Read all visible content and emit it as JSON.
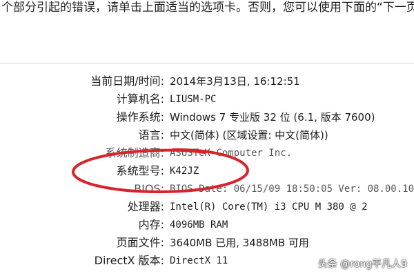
{
  "header": {
    "instruction_text": "个部分引起的错误，请单击上面适当的选项卡。否则，您可以使用下面的“下一页”"
  },
  "system_info": {
    "rows": [
      {
        "label": "当前日期/时间:",
        "value": "2014年3月13日, 16:12:51"
      },
      {
        "label": "计算机名:",
        "value": "LIUSM-PC"
      },
      {
        "label": "操作系统:",
        "value": "Windows 7 专业版 32 位 (6.1, 版本 7600)"
      },
      {
        "label": "语言:",
        "value": "中文(简体) (区域设置: 中文(简体))"
      },
      {
        "label": "系统制造商:",
        "value": "ASUSTeK Computer Inc."
      },
      {
        "label": "系统型号:",
        "value": "K42JZ"
      },
      {
        "label": "BIOS:",
        "value": "BIOS Date: 06/15/09 18:50:05 Ver: 08.00.10"
      },
      {
        "label": "处理器:",
        "value": "Intel(R) Core(TM) i3 CPU       M 380  @ 2"
      },
      {
        "label": "内存:",
        "value": "4096MB RAM"
      },
      {
        "label": "页面文件:",
        "value": "3640MB 已用, 3488MB 可用"
      },
      {
        "label": "DirectX 版本:",
        "value": "DirectX 11"
      }
    ]
  },
  "annotation": {
    "ellipse_color": "#d9232a"
  },
  "watermark": {
    "text": "头条 @rong平凡人9"
  }
}
